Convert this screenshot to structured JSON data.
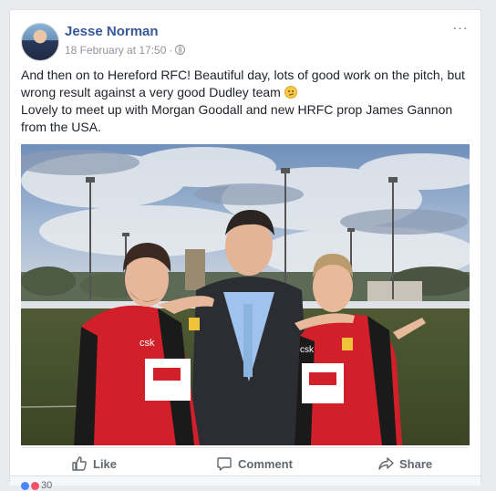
{
  "post": {
    "author": "Jesse Norman",
    "timestamp": "18 February at 17:50",
    "separator": "·",
    "privacy_icon": "globe-icon",
    "more_icon": "···",
    "text_line1": "And then on to Hereford RFC! Beautiful day, lots of good work on the pitch, but wrong result against a very good Dudley team",
    "text_line2": "Lovely to meet up with Morgan Goodall and new HRFC prop James Gannon from the USA.",
    "emoji": "slightly-frowning-face-emoji"
  },
  "photo": {
    "kit_sponsor_left": "csk",
    "kit_sponsor_right": "csk"
  },
  "actions": {
    "like_label": "Like",
    "comment_label": "Comment",
    "share_label": "Share"
  },
  "reactions": {
    "count": "30"
  },
  "colors": {
    "link_blue": "#365899",
    "meta_grey": "#90949c",
    "action_grey": "#606770",
    "jersey_red": "#d2202a"
  }
}
